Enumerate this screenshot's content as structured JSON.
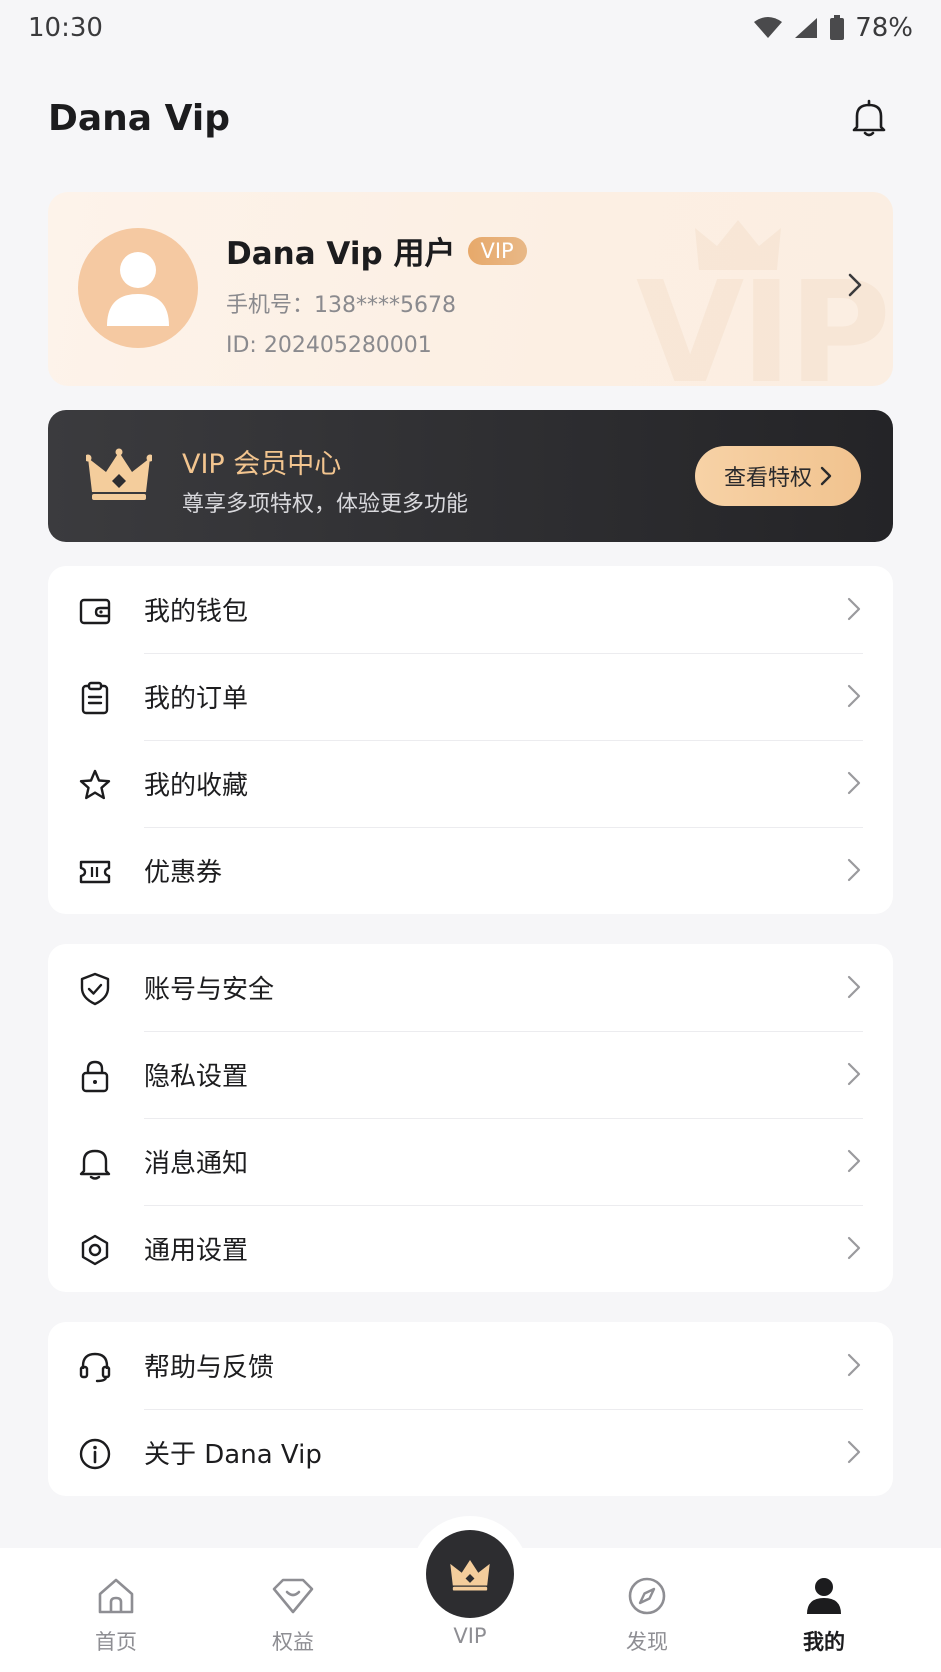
{
  "status_bar": {
    "time": "10:30",
    "battery": "78%"
  },
  "header": {
    "title": "Dana Vip"
  },
  "profile": {
    "name": "Dana Vip 用户",
    "badge": "VIP",
    "phone": "手机号：138****5678",
    "id": "ID: 202405280001",
    "watermark": "VIP"
  },
  "vip_banner": {
    "title": "VIP 会员中心",
    "subtitle": "尊享多项特权，体验更多功能",
    "button": "查看特权"
  },
  "menu_groups": [
    {
      "items": [
        {
          "label": "我的钱包",
          "icon": "wallet-icon"
        },
        {
          "label": "我的订单",
          "icon": "order-icon"
        },
        {
          "label": "我的收藏",
          "icon": "star-icon"
        },
        {
          "label": "优惠券",
          "icon": "coupon-icon"
        }
      ]
    },
    {
      "items": [
        {
          "label": "账号与安全",
          "icon": "shield-icon"
        },
        {
          "label": "隐私设置",
          "icon": "lock-icon"
        },
        {
          "label": "消息通知",
          "icon": "bell-icon"
        },
        {
          "label": "通用设置",
          "icon": "gear-icon"
        }
      ]
    },
    {
      "items": [
        {
          "label": "帮助与反馈",
          "icon": "headset-icon"
        },
        {
          "label": "关于 Dana Vip",
          "icon": "info-icon"
        }
      ]
    }
  ],
  "tabs": [
    {
      "label": "首页",
      "icon": "home-icon"
    },
    {
      "label": "权益",
      "icon": "diamond-icon"
    },
    {
      "label": "VIP",
      "icon": "crown-icon"
    },
    {
      "label": "发现",
      "icon": "compass-icon"
    },
    {
      "label": "我的",
      "icon": "person-icon",
      "active": true
    }
  ],
  "colors": {
    "accent": "#f3c58f",
    "dark": "#2d2d30",
    "avatar": "#f5c9a2"
  }
}
